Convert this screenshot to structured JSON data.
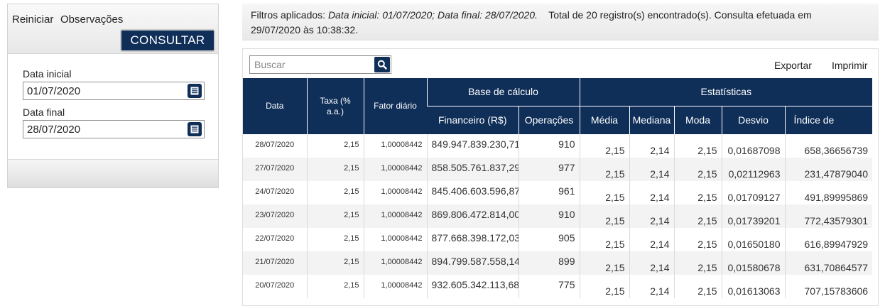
{
  "filter": {
    "reset_label": "Reiniciar",
    "notes_label": "Observações",
    "consult_label": "CONSULTAR",
    "start_label": "Data inicial",
    "start_value": "01/07/2020",
    "end_label": "Data final",
    "end_value": "28/07/2020"
  },
  "info": {
    "prefix": "Filtros aplicados: ",
    "filters": "Data inicial: 01/07/2020; Data final: 28/07/2020.",
    "summary": "Total de 20 registro(s) encontrado(s). Consulta efetuada em",
    "timestamp": "29/07/2020 às 10:38:32."
  },
  "toolbar": {
    "search_placeholder": "Buscar",
    "export_label": "Exportar",
    "print_label": "Imprimir"
  },
  "table": {
    "headers": {
      "date": "Data",
      "rate": "Taxa (% a.a.)",
      "factor": "Fator diário",
      "base_group": "Base de cálculo",
      "stats_group": "Estatísticas",
      "financial": "Financeiro (R$)",
      "operations": "Operações",
      "mean": "Média",
      "median": "Mediana",
      "mode": "Moda",
      "deviation": "Desvio",
      "index": "Índice de"
    },
    "rows": [
      {
        "date": "28/07/2020",
        "rate": "2,15",
        "factor": "1,00008442",
        "financial": "849.947.839.230,71",
        "operations": "910",
        "mean": "2,15",
        "median": "2,14",
        "mode": "2,15",
        "deviation": "0,01687098",
        "index": "658,36656739"
      },
      {
        "date": "27/07/2020",
        "rate": "2,15",
        "factor": "1,00008442",
        "financial": "858.505.761.837,29",
        "operations": "977",
        "mean": "2,15",
        "median": "2,14",
        "mode": "2,15",
        "deviation": "0,02112963",
        "index": "231,47879040"
      },
      {
        "date": "24/07/2020",
        "rate": "2,15",
        "factor": "1,00008442",
        "financial": "845.406.603.596,87",
        "operations": "961",
        "mean": "2,15",
        "median": "2,14",
        "mode": "2,15",
        "deviation": "0,01709127",
        "index": "491,89995869"
      },
      {
        "date": "23/07/2020",
        "rate": "2,15",
        "factor": "1,00008442",
        "financial": "869.806.472.814,00",
        "operations": "910",
        "mean": "2,15",
        "median": "2,14",
        "mode": "2,15",
        "deviation": "0,01739201",
        "index": "772,43579301"
      },
      {
        "date": "22/07/2020",
        "rate": "2,15",
        "factor": "1,00008442",
        "financial": "877.668.398.172,03",
        "operations": "905",
        "mean": "2,15",
        "median": "2,14",
        "mode": "2,15",
        "deviation": "0,01650180",
        "index": "616,89947929"
      },
      {
        "date": "21/07/2020",
        "rate": "2,15",
        "factor": "1,00008442",
        "financial": "894.799.587.558,14",
        "operations": "899",
        "mean": "2,15",
        "median": "2,14",
        "mode": "2,15",
        "deviation": "0,01580678",
        "index": "631,70864577"
      },
      {
        "date": "20/07/2020",
        "rate": "2,15",
        "factor": "1,00008442",
        "financial": "932.605.342.113,68",
        "operations": "775",
        "mean": "2,15",
        "median": "2,14",
        "mode": "2,15",
        "deviation": "0,01613063",
        "index": "707,15783606"
      }
    ]
  },
  "colors": {
    "brand_navy": "#0f2e58",
    "row_alt": "#f3f3f3"
  }
}
